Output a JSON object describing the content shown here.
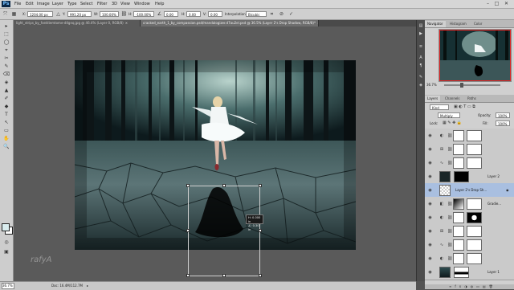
{
  "app": {
    "logo": "Ps"
  },
  "menu": [
    "File",
    "Edit",
    "Image",
    "Layer",
    "Type",
    "Select",
    "Filter",
    "3D",
    "View",
    "Window",
    "Help"
  ],
  "window_controls": {
    "minimize": "–",
    "maximize": "□",
    "close": "✕"
  },
  "options_bar": {
    "x_label": "X:",
    "x_value": "1204.00 px",
    "y_label": "Y:",
    "y_value": "991.20 px",
    "w_label": "W:",
    "w_value": "100.00%",
    "h_label": "H:",
    "h_value": "-100.00%",
    "angle_value": "0.00",
    "hskew_label": "H:",
    "hskew_value": "0.00",
    "vskew_label": "V:",
    "vskew_value": "0.00",
    "interpolation_label": "Interpolation:",
    "interpolation_value": "Bicubic",
    "cancel_icon": "⊘",
    "commit_icon": "✓"
  },
  "tabs": [
    {
      "title": "light_strips_by_fxeldiemtome-d4gnq.jpg @ 46.4% (Layer 0, RGB/8)",
      "close": "×",
      "active": false
    },
    {
      "title": "cracked_earth_1_by_compassion.psd/mandalogizer.d7au2el.psd @ 36.5% (Layer 2's Drop Shadow, RGB/8)*",
      "close": "×",
      "active": true
    }
  ],
  "transform_readout": {
    "line1": "H: 0.000 in",
    "line2": "∠: 0.30° in"
  },
  "watermark": "rafyA",
  "status": {
    "zoom": "36.7%",
    "doc": "Doc: 16.4M/112.7M",
    "arrow": "▸"
  },
  "navigator": {
    "tabs": [
      "Navigator",
      "Histogram",
      "Color"
    ],
    "zoom": "36.7%"
  },
  "layers_panel": {
    "tabs": [
      "Layers",
      "Channels",
      "Paths"
    ],
    "kind_label": "Kind",
    "blend_mode": "Multiply",
    "opacity_label": "Opacity:",
    "opacity_value": "100%",
    "lock_label": "Lock:",
    "fill_label": "Fill:",
    "fill_value": "100%",
    "layers": [
      {
        "name": "",
        "icon": "◐",
        "thumb": "white",
        "mask": "white",
        "selected": false
      },
      {
        "name": "",
        "icon": "⊞",
        "thumb": "white",
        "mask": "white",
        "selected": false
      },
      {
        "name": "",
        "icon": "∿",
        "thumb": "white",
        "mask": "white",
        "selected": false
      },
      {
        "name": "Layer 2",
        "icon": "",
        "thumb": "dark",
        "mask": "black",
        "selected": false
      },
      {
        "name": "Layer 2's Drop Sh...",
        "icon": "",
        "thumb": "checker",
        "mask": "",
        "selected": true
      },
      {
        "name": "Gradie...",
        "icon": "◧",
        "thumb": "gradient",
        "mask": "white",
        "selected": false
      },
      {
        "name": "",
        "icon": "◐",
        "thumb": "white",
        "mask": "black-spot",
        "selected": false
      },
      {
        "name": "",
        "icon": "⊞",
        "thumb": "white",
        "mask": "white",
        "selected": false
      },
      {
        "name": "",
        "icon": "∿",
        "thumb": "white",
        "mask": "white",
        "selected": false
      },
      {
        "name": "",
        "icon": "◐",
        "thumb": "white",
        "mask": "white",
        "selected": false
      },
      {
        "name": "Layer 1",
        "icon": "",
        "thumb": "photo",
        "mask": "white-strip",
        "selected": false
      }
    ],
    "footer_icons": [
      "∞",
      "fx",
      "◑",
      "◍",
      "▭",
      "▤",
      "🗑"
    ]
  },
  "tools": [
    "▸",
    "⬚",
    "◯",
    "⌖",
    "✂",
    "✎",
    "⌫",
    "◈",
    "▲",
    "✐",
    "◆",
    "T",
    "↖",
    "▭",
    "✋",
    "🔍"
  ],
  "colors": {
    "fg": "#d9ecee",
    "bg": "#ffffff",
    "selected_layer": "#a9bfe0"
  }
}
